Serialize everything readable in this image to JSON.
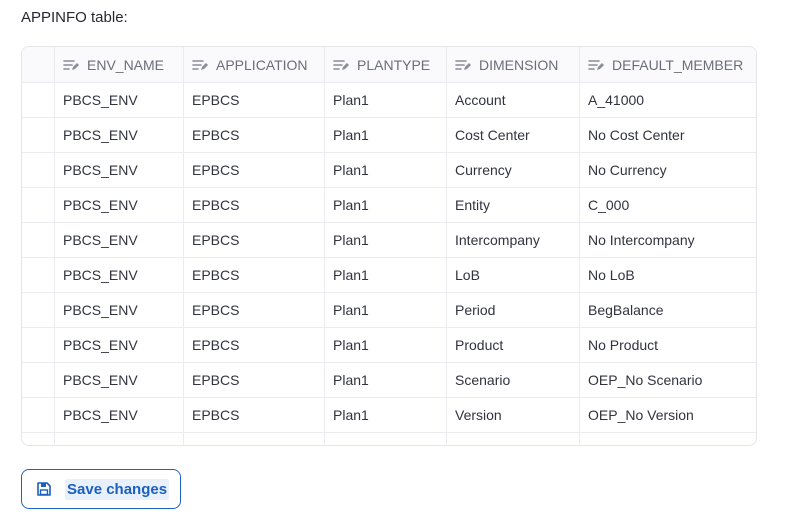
{
  "caption": "APPINFO table:",
  "table": {
    "columns": [
      "ENV_NAME",
      "APPLICATION",
      "PLANTYPE",
      "DIMENSION",
      "DEFAULT_MEMBER"
    ],
    "rows": [
      [
        "PBCS_ENV",
        "EPBCS",
        "Plan1",
        "Account",
        "A_41000"
      ],
      [
        "PBCS_ENV",
        "EPBCS",
        "Plan1",
        "Cost Center",
        "No Cost Center"
      ],
      [
        "PBCS_ENV",
        "EPBCS",
        "Plan1",
        "Currency",
        "No Currency"
      ],
      [
        "PBCS_ENV",
        "EPBCS",
        "Plan1",
        "Entity",
        "C_000"
      ],
      [
        "PBCS_ENV",
        "EPBCS",
        "Plan1",
        "Intercompany",
        "No Intercompany"
      ],
      [
        "PBCS_ENV",
        "EPBCS",
        "Plan1",
        "LoB",
        "No LoB"
      ],
      [
        "PBCS_ENV",
        "EPBCS",
        "Plan1",
        "Period",
        "BegBalance"
      ],
      [
        "PBCS_ENV",
        "EPBCS",
        "Plan1",
        "Product",
        "No Product"
      ],
      [
        "PBCS_ENV",
        "EPBCS",
        "Plan1",
        "Scenario",
        "OEP_No Scenario"
      ],
      [
        "PBCS_ENV",
        "EPBCS",
        "Plan1",
        "Version",
        "OEP_No Version"
      ]
    ],
    "column_icon": "text-column-icon"
  },
  "save_button": {
    "label": "Save changes",
    "icon": "floppy-disk-icon",
    "accent": "#1b5fbf"
  }
}
